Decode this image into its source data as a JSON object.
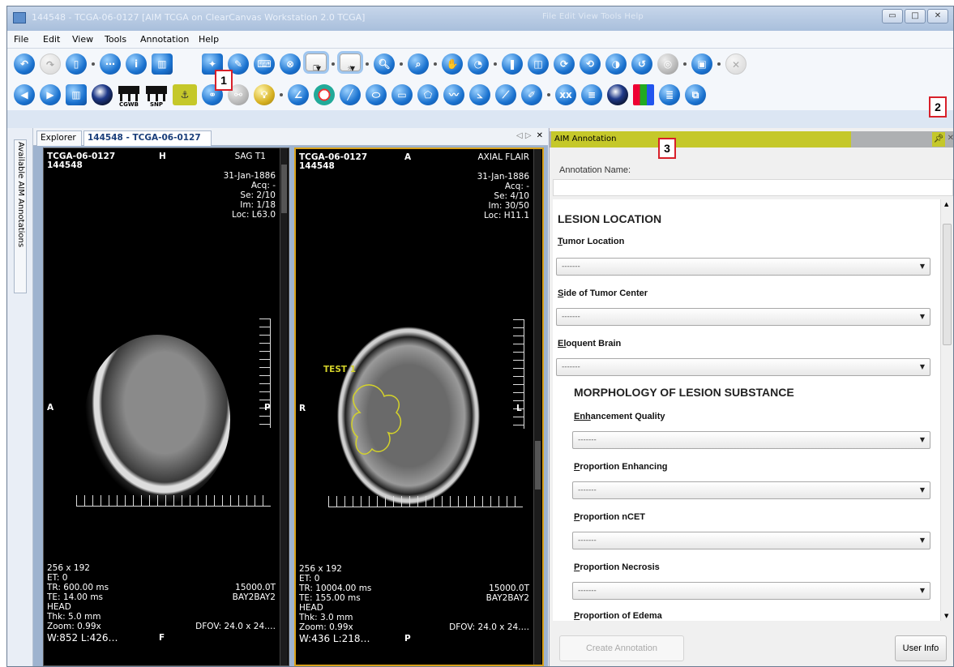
{
  "window": {
    "title": "144548 - TCGA-06-0127 [AIM TCGA on ClearCanvas Workstation 2.0 TCGA]",
    "ghost_menu": "File  Edit  View  Tools  Help"
  },
  "menu": [
    "File",
    "Edit",
    "View",
    "Tools",
    "Annotation",
    "Help"
  ],
  "callouts": [
    "1",
    "2",
    "3"
  ],
  "toolbar2": {
    "cgwb": "CGWB",
    "snp": "SNP"
  },
  "side_tab": "Available AIM Annotations",
  "tabs": {
    "explorer": "Explorer",
    "study": "144548 - TCGA-06-0127"
  },
  "viewer_left": {
    "patient_id": "TCGA-06-0127",
    "accession": "144548",
    "orient_top": "H",
    "series_desc": "SAG T1",
    "date": "31-Jan-1886",
    "acq": "Acq: -",
    "series": "Se: 2/10",
    "image": "Im: 1/18",
    "loc": "Loc: L63.0",
    "left_label": "A",
    "right_label": "P",
    "bottom_label": "F",
    "matrix": "256 x 192",
    "et": "ET: 0",
    "tr": "TR: 600.00 ms",
    "te": "TE: 14.00 ms",
    "body_part": "HEAD",
    "thk": "Thk: 5.0 mm",
    "zoom": "Zoom: 0.99x",
    "wl": "W:852 L:426…",
    "field": "15000.0T",
    "station": "BAY2BAY2",
    "dfov": "DFOV: 24.0 x 24…."
  },
  "viewer_right": {
    "patient_id": "TCGA-06-0127",
    "accession": "144548",
    "orient_top": "A",
    "series_desc": "AXIAL FLAIR",
    "date": "31-Jan-1886",
    "acq": "Acq: -",
    "series": "Se: 4/10",
    "image": "Im: 30/50",
    "loc": "Loc: H11.1",
    "left_label": "R",
    "right_label": "L",
    "bottom_label": "P",
    "annotation_label": "TEST 1",
    "matrix": "256 x 192",
    "et": "ET: 0",
    "tr": "TR: 10004.00 ms",
    "te": "TE: 155.00 ms",
    "body_part": "HEAD",
    "thk": "Thk: 3.0 mm",
    "zoom": "Zoom: 0.99x",
    "wl": "W:436 L:218…",
    "field": "15000.0T",
    "station": "BAY2BAY2",
    "dfov": "DFOV: 24.0 x 24…."
  },
  "panel": {
    "title": "AIM Annotation",
    "annotation_name_label": "Annotation Name:",
    "annotation_name_value": "",
    "section1": "LESION LOCATION",
    "section2": "MORPHOLOGY OF LESION SUBSTANCE",
    "fields": [
      {
        "accel": "T",
        "rest": "umor Location",
        "value": "-------"
      },
      {
        "accel": "S",
        "rest": "ide of Tumor Center",
        "value": "-------"
      },
      {
        "accel": "El",
        "rest": "oquent Brain",
        "value": "-------"
      },
      {
        "accel": "Enh",
        "rest": "ancement Quality",
        "value": "-------"
      },
      {
        "accel": "P",
        "rest": "roportion Enhancing",
        "value": "-------"
      },
      {
        "accel": "P",
        "rest": "roportion nCET",
        "value": "-------"
      },
      {
        "accel": "P",
        "rest": "roportion Necrosis",
        "value": "-------"
      },
      {
        "accel": "P",
        "rest": "roportion of Edema",
        "value": ""
      }
    ],
    "create_button": "Create Annotation",
    "userinfo_button": "User Info"
  },
  "colors": {
    "highlight": "#c5c82a",
    "callout_border": "#d8202a",
    "active_viewer_border": "#d9a21c",
    "roi": "#d4d22a"
  }
}
